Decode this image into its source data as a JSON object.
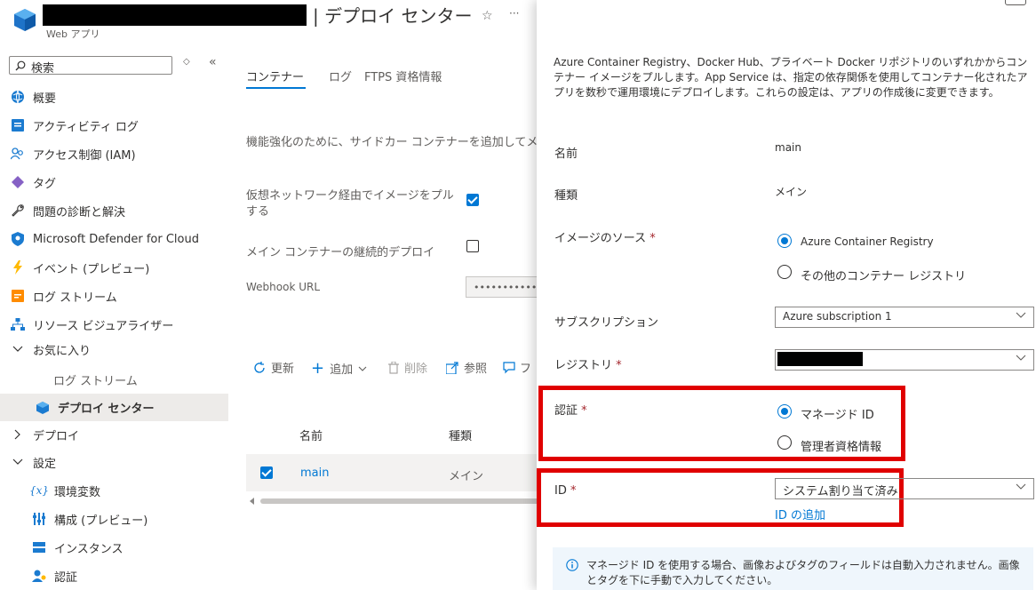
{
  "header": {
    "title": "| デプロイ センター",
    "subtitle": "Web アプリ",
    "star_icon": "☆",
    "more_icon": "···"
  },
  "sidebar": {
    "search_placeholder": "検索",
    "items": [
      {
        "label": "概要"
      },
      {
        "label": "アクティビティ ログ"
      },
      {
        "label": "アクセス制御 (IAM)"
      },
      {
        "label": "タグ"
      },
      {
        "label": "問題の診断と解決"
      },
      {
        "label": "Microsoft Defender for Cloud"
      },
      {
        "label": "イベント (プレビュー)"
      },
      {
        "label": "ログ ストリーム"
      },
      {
        "label": "リソース ビジュアライザー"
      },
      {
        "label": "お気に入り"
      },
      {
        "label": "ログ ストリーム"
      },
      {
        "label": "デプロイ センター"
      },
      {
        "label": "デプロイ"
      },
      {
        "label": "設定"
      },
      {
        "label": "環境変数"
      },
      {
        "label": "構成 (プレビュー)"
      },
      {
        "label": "インスタンス"
      },
      {
        "label": "認証"
      }
    ]
  },
  "main": {
    "tabs": [
      {
        "label": "コンテナー"
      },
      {
        "label": "ログ"
      },
      {
        "label": "FTPS 資格情報"
      }
    ],
    "sidecar_info": "機能強化のために、サイドカー コンテナーを追加してメイ",
    "vnet_label": "仮想ネットワーク経由でイメージをプルする",
    "vnet_checked": true,
    "cd_label": "メイン コンテナーの継続的デプロイ",
    "cd_checked": false,
    "webhook_label": "Webhook URL",
    "webhook_value": "••••••••••••••••",
    "toolbar": {
      "refresh": "更新",
      "add": "追加",
      "delete": "削除",
      "browse": "参照",
      "more": "フ"
    },
    "table": {
      "headers": [
        "名前",
        "種類"
      ],
      "rows": [
        {
          "name": "main",
          "type": "メイン",
          "checked": true
        }
      ]
    }
  },
  "panel": {
    "description": "Azure Container Registry、Docker Hub、プライベート Docker リポジトリのいずれかからコンテナー イメージをプルします。App Service は、指定の依存関係を使用してコンテナー化されたアプリを数秒で運用環境にデプロイします。これらの設定は、アプリの作成後に変更できます。",
    "fields": {
      "name": {
        "label": "名前",
        "value": "main"
      },
      "type": {
        "label": "種類",
        "value": "メイン"
      },
      "image_source": {
        "label": "イメージのソース",
        "options": [
          "Azure Container Registry",
          "その他のコンテナー レジストリ"
        ],
        "selected": "Azure Container Registry"
      },
      "subscription": {
        "label": "サブスクリプション",
        "value": "Azure subscription 1"
      },
      "registry": {
        "label": "レジストリ",
        "value": ""
      },
      "auth": {
        "label": "認証",
        "options": [
          "マネージド ID",
          "管理者資格情報"
        ],
        "selected": "マネージド ID"
      },
      "id": {
        "label": "ID",
        "value": "システム割り当て済み",
        "add_link": "ID の追加"
      }
    },
    "required_mark": "*",
    "info": "マネージド ID を使用する場合、画像およびタグのフィールドは自動入力されません。画像とタグを下に手動で入力してください。",
    "highlight_color": "#e00000"
  },
  "colors": {
    "accent": "#0078d4",
    "selected_bg": "#edebe9"
  }
}
